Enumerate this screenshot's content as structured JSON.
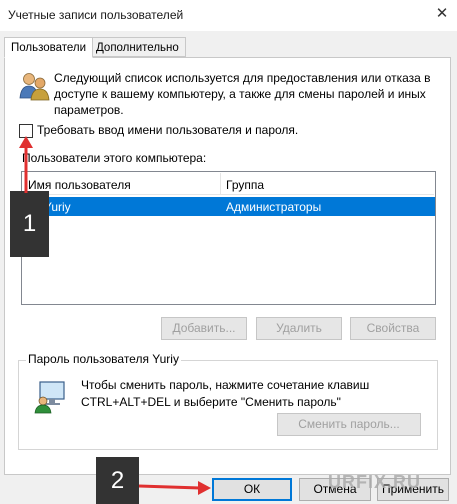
{
  "window": {
    "title": "Учетные записи пользователей",
    "close_glyph": "✕"
  },
  "tabs": [
    {
      "label": "Пользователи",
      "active": true
    },
    {
      "label": "Дополнительно",
      "active": false
    }
  ],
  "description": "Следующий список используется для предоставления или отказа в доступе к вашему компьютеру, а также для смены паролей и иных параметров.",
  "require_login_checkbox": {
    "label": "Требовать ввод имени пользователя и пароля.",
    "checked": false
  },
  "users_label": "Пользователи этого компьютера:",
  "users_table": {
    "columns": [
      "Имя пользователя",
      "Группа"
    ],
    "rows": [
      {
        "name": "Yuriy",
        "group": "Администраторы",
        "selected": true
      }
    ]
  },
  "user_buttons": {
    "add": "Добавить...",
    "remove": "Удалить",
    "properties": "Свойства"
  },
  "password_group": {
    "title": "Пароль пользователя Yuriy",
    "text": "Чтобы сменить пароль, нажмите сочетание клавиш CTRL+ALT+DEL и выберите \"Сменить пароль\"",
    "button": "Сменить пароль..."
  },
  "dialog_buttons": {
    "ok": "ОК",
    "cancel": "Отмена",
    "apply": "Применить"
  },
  "markers": [
    "1",
    "2"
  ],
  "watermark": "URFIX.RU",
  "colors": {
    "selection": "#0078d7",
    "arrow": "#e03030",
    "marker_bg": "#333333"
  }
}
